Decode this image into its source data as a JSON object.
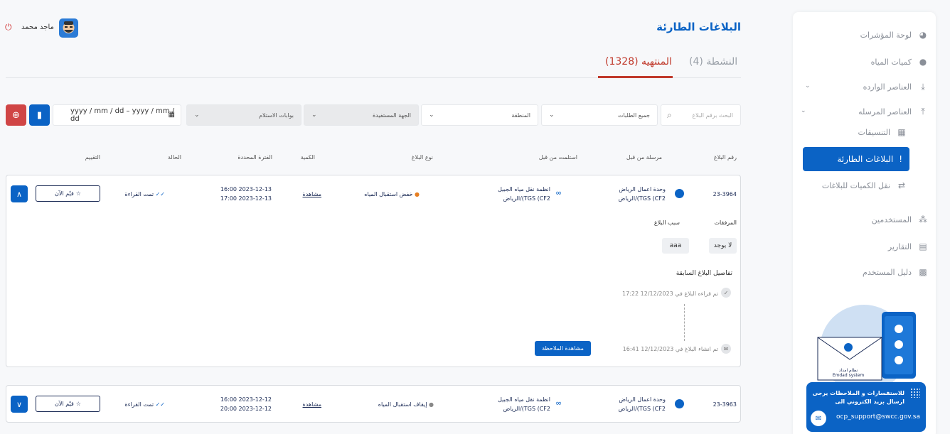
{
  "sidebar": {
    "items": [
      {
        "label": "لوحة المؤشرات",
        "icon": "pie-chart-icon"
      },
      {
        "label": "كميات المياه",
        "icon": "water-drop-icon"
      },
      {
        "label": "العناصر الوارده",
        "icon": "inbox-icon"
      },
      {
        "label": "العناصر المرسله",
        "icon": "outbox-icon"
      },
      {
        "label": "التنسيقات",
        "icon": "calendar-icon"
      },
      {
        "label": "البلاغات الطارئة",
        "icon": "alert-icon"
      },
      {
        "label": "نقل الكميات للبلاغات",
        "icon": "transfer-icon"
      },
      {
        "label": "المستخدمين",
        "icon": "users-icon"
      },
      {
        "label": "التقارير",
        "icon": "report-icon"
      },
      {
        "label": "دليل المستخدم",
        "icon": "guide-icon"
      }
    ],
    "illustration": {
      "system_name_ar": "نظام امداد",
      "system_name_en": "Emdad system"
    },
    "support": {
      "text": "للاستفسارات و الملاحظات يرجى ارسال بريد الكتروني الى",
      "email": "ocp_support@swcc.gov.sa"
    }
  },
  "header": {
    "title": "البلاغات الطارئة",
    "user_name": "ماجد محمد"
  },
  "tabs": [
    {
      "label": "المنتهيه (1328)",
      "active": true
    },
    {
      "label": "النشطة (4)",
      "active": false
    }
  ],
  "filters": {
    "search_placeholder": "البحث برقم البلاغ",
    "requests": "جميع الطلبات",
    "region": "المنطقة",
    "beneficiary": "الجهة المستفيدة",
    "gates": "بوابات الاستلام",
    "date_range": "yyyy / mm / dd – yyyy / mm / dd"
  },
  "table": {
    "headers": [
      "رقم البلاغ",
      "مرسلة من قبل",
      "استلمت من قبل",
      "نوع البلاغ",
      "الكمية",
      "الفترة المحددة",
      "الحالة",
      "التقييم"
    ],
    "rows": [
      {
        "id": "23-3964",
        "sent_by_1": "وحدة اعمال الرياض",
        "sent_by_2": "الرياض/(TGS (CF2",
        "received_by_1": "انظمة نقل مياه الجبيل",
        "received_by_2": "الرياض/(TGS (CF2",
        "type": "خفض استقبال المياه",
        "quantity": "مشاهدة",
        "period_from": "16:00 2023-12-13",
        "period_to": "17:00 2023-12-13",
        "status": "تمت القراءة",
        "rate": "قيّم الآن"
      },
      {
        "id": "23-3963",
        "sent_by_1": "وحدة اعمال الرياض",
        "sent_by_2": "الرياض/(TGS (CF2",
        "received_by_1": "انظمة نقل مياه الجبيل",
        "received_by_2": "الرياض/(TGS (CF2",
        "type": "إيقاف استقبال المياه",
        "quantity": "مشاهدة",
        "period_from": "16:00 2023-12-12",
        "period_to": "20:00 2023-12-12",
        "status": "تمت القراءة",
        "rate": "قيّم الآن"
      }
    ]
  },
  "detail": {
    "attachments_label": "المرفقات",
    "reason_label": "سبب البلاغ",
    "attachments_value": "لا يوجد",
    "reason_value": "aaa",
    "history_title": "تفاصيل البلاغ السابقة",
    "event_read": "تم قراءه البلاغ في 12/12/2023 17:22",
    "event_created": "تم انشاء البلاغ في 12/12/2023 16:41",
    "note_button": "مشاهدة الملاحظة"
  },
  "colors": {
    "primary": "#0b63c5",
    "danger": "#c0392b",
    "navy": "#1a2a55"
  }
}
